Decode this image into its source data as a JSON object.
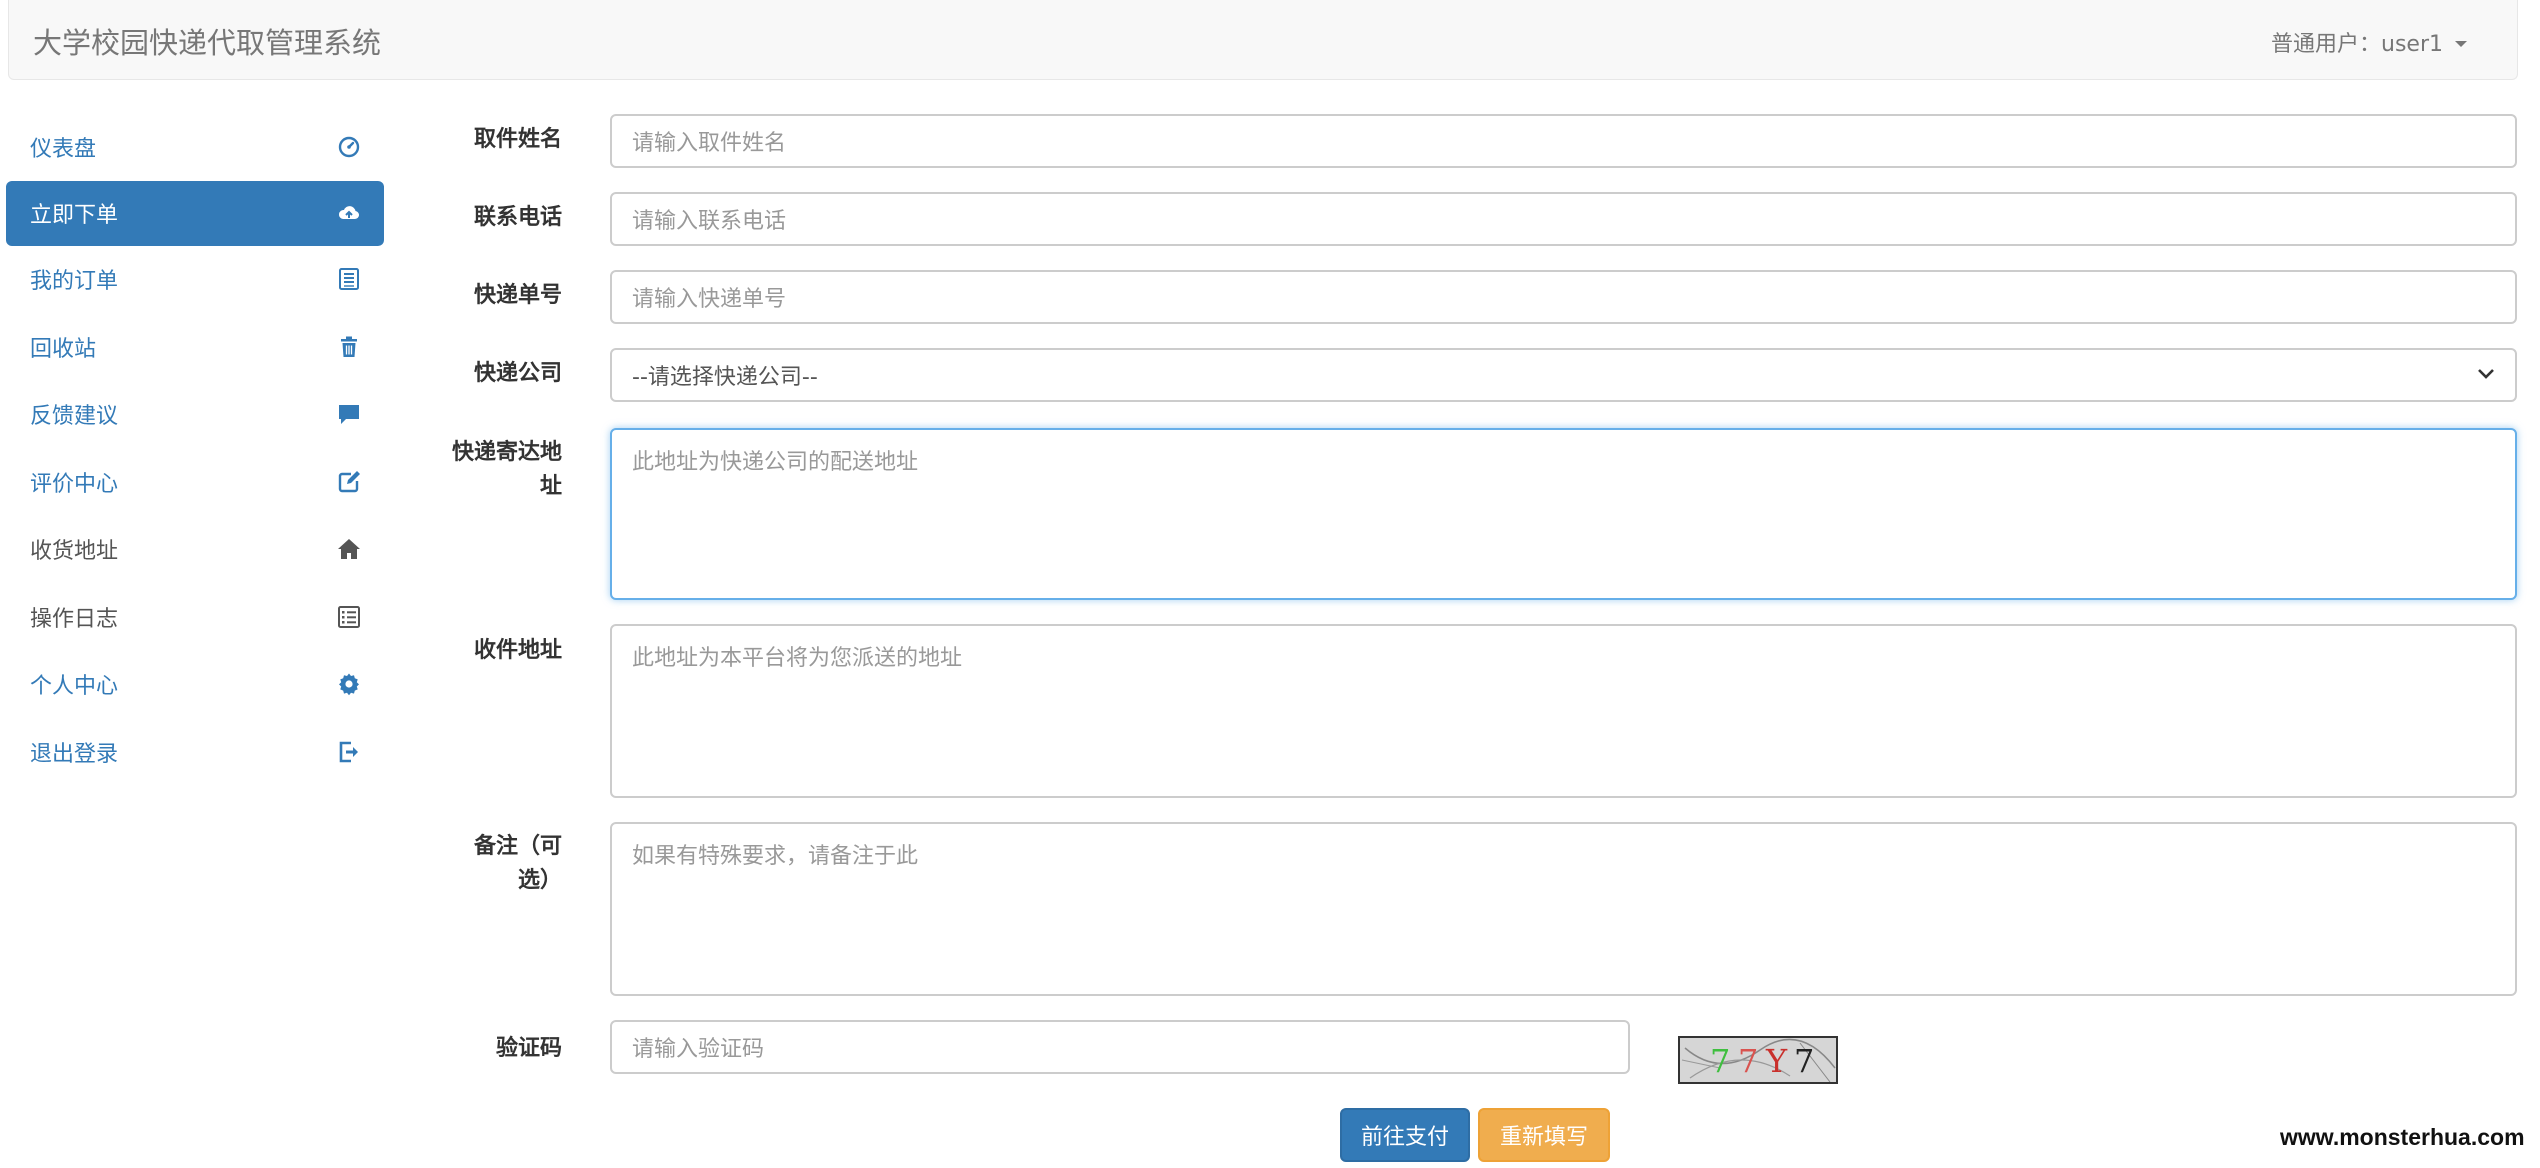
{
  "navbar": {
    "brand": "大学校园快递代取管理系统",
    "user_menu": "普通用户：user1"
  },
  "sidebar": {
    "items": [
      {
        "label": "仪表盘",
        "icon": "dashboard-icon"
      },
      {
        "label": "立即下单",
        "icon": "cloud-upload-icon"
      },
      {
        "label": "我的订单",
        "icon": "list-icon"
      },
      {
        "label": "回收站",
        "icon": "trash-icon"
      },
      {
        "label": "反馈建议",
        "icon": "comment-icon"
      },
      {
        "label": "评价中心",
        "icon": "edit-icon"
      },
      {
        "label": "收货地址",
        "icon": "home-icon"
      },
      {
        "label": "操作日志",
        "icon": "list-alt-icon"
      },
      {
        "label": "个人中心",
        "icon": "gear-icon"
      },
      {
        "label": "退出登录",
        "icon": "logout-icon"
      }
    ],
    "active_index": 1
  },
  "form": {
    "name": {
      "label": "取件姓名",
      "placeholder": "请输入取件姓名"
    },
    "phone": {
      "label": "联系电话",
      "placeholder": "请输入联系电话"
    },
    "tracking": {
      "label": "快递单号",
      "placeholder": "请输入快递单号"
    },
    "company": {
      "label": "快递公司",
      "selected": "--请选择快递公司--"
    },
    "send_address": {
      "label_line1": "快递寄达地",
      "label_line2": "址",
      "placeholder": "此地址为快递公司的配送地址"
    },
    "receive_address": {
      "label": "收件地址",
      "placeholder": "此地址为本平台将为您派送的地址"
    },
    "note": {
      "label_line1": "备注（可",
      "label_line2": "选）",
      "placeholder": "如果有特殊要求，请备注于此"
    },
    "captcha": {
      "label": "验证码",
      "placeholder": "请输入验证码",
      "image_text": "7 7 Y 7"
    }
  },
  "buttons": {
    "pay": "前往支付",
    "reset": "重新填写"
  },
  "watermark": "www.monsterhua.com",
  "colors": {
    "primary": "#337ab7",
    "warning": "#f0ad4e",
    "focus": "#66afe9"
  }
}
